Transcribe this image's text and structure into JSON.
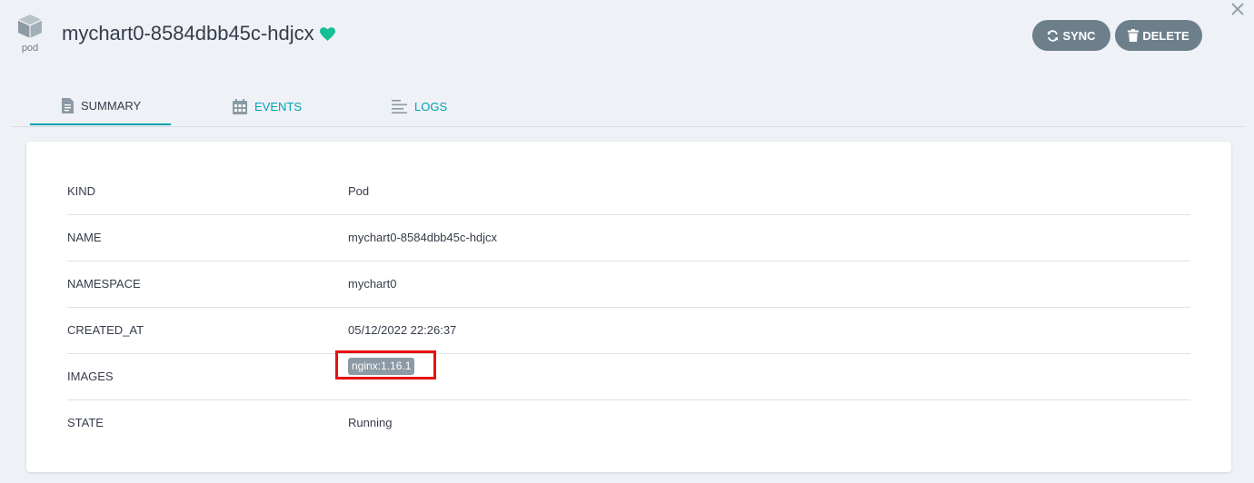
{
  "header": {
    "kind_label": "pod",
    "title": "mychart0-8584dbb45c-hdjcx",
    "sync_label": "SYNC",
    "delete_label": "DELETE"
  },
  "tabs": [
    {
      "label": "SUMMARY",
      "active": true
    },
    {
      "label": "EVENTS",
      "active": false
    },
    {
      "label": "LOGS",
      "active": false
    }
  ],
  "summary": {
    "rows": [
      {
        "key": "KIND",
        "value": "Pod"
      },
      {
        "key": "NAME",
        "value": "mychart0-8584dbb45c-hdjcx"
      },
      {
        "key": "NAMESPACE",
        "value": "mychart0"
      },
      {
        "key": "CREATED_AT",
        "value": "05/12/2022 22:26:37"
      },
      {
        "key": "IMAGES",
        "value": "nginx:1.16.1"
      },
      {
        "key": "STATE",
        "value": "Running"
      }
    ]
  },
  "colors": {
    "accent": "#00a2b3",
    "button": "#6d7f8b",
    "highlight": "#e81010",
    "health_heart": "#18be94"
  },
  "icons": {
    "kind": "pod-cube-icon",
    "health": "heart-icon",
    "sync": "sync-icon",
    "delete": "trash-icon",
    "close": "close-icon",
    "summary_tab": "document-icon",
    "events_tab": "calendar-icon",
    "logs_tab": "lines-icon"
  }
}
